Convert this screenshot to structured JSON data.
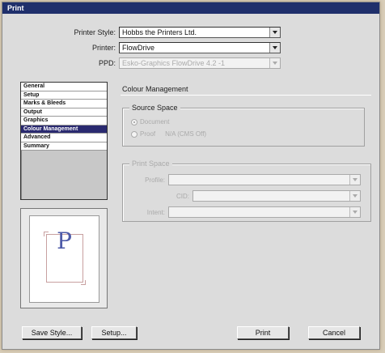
{
  "window": {
    "title": "Print"
  },
  "top": {
    "printer_style": {
      "label": "Printer Style:",
      "value": "Hobbs the Printers Ltd."
    },
    "printer": {
      "label": "Printer:",
      "value": "FlowDrive"
    },
    "ppd": {
      "label": "PPD:",
      "value": "Esko-Graphics FlowDrive 4.2 -1"
    }
  },
  "nav": {
    "items": [
      "General",
      "Setup",
      "Marks & Bleeds",
      "Output",
      "Graphics",
      "Colour Management",
      "Advanced",
      "Summary"
    ],
    "selected_index": 5
  },
  "preview": {
    "letter": "P"
  },
  "panel": {
    "title": "Colour Management",
    "source_space": {
      "title": "Source Space",
      "option_document": "Document",
      "option_proof": "Proof",
      "proof_value": "N/A (CMS Off)"
    },
    "print_space": {
      "title": "Print Space",
      "profile_label": "Profile:",
      "cid_label": "CID:",
      "intent_label": "Intent:"
    }
  },
  "buttons": {
    "save_style": "Save Style...",
    "setup": "Setup...",
    "print": "Print",
    "cancel": "Cancel"
  }
}
